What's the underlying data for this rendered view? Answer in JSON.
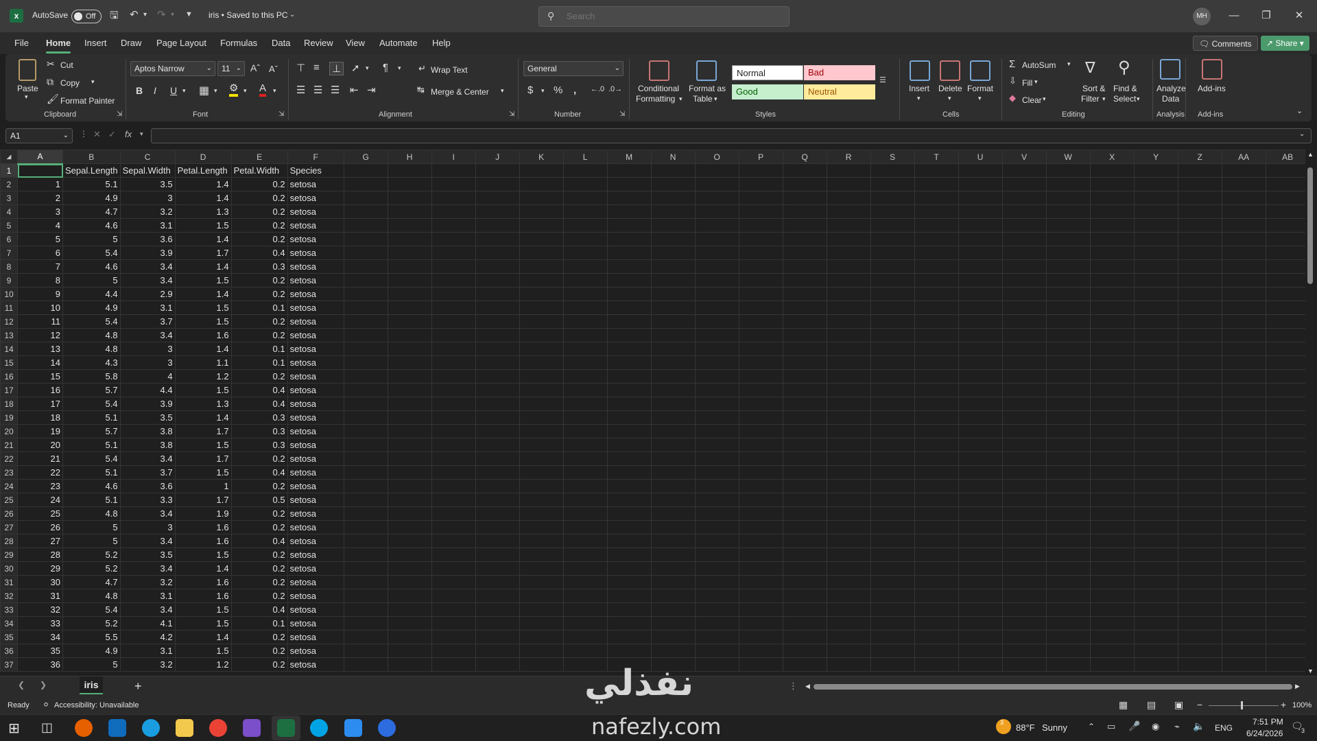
{
  "titlebar": {
    "autosave_label": "AutoSave",
    "autosave_state": "Off",
    "doc_title": "iris • Saved to this PC",
    "search_placeholder": "Search",
    "user_initials": "MH"
  },
  "menu": {
    "tabs": [
      "File",
      "Home",
      "Insert",
      "Draw",
      "Page Layout",
      "Formulas",
      "Data",
      "Review",
      "View",
      "Automate",
      "Help"
    ],
    "active": "Home",
    "comments_label": "Comments",
    "share_label": "Share"
  },
  "ribbon": {
    "clipboard": {
      "paste": "Paste",
      "cut": "Cut",
      "copy": "Copy",
      "format_painter": "Format Painter",
      "group": "Clipboard"
    },
    "font": {
      "name": "Aptos Narrow",
      "size": "11",
      "group": "Font"
    },
    "alignment": {
      "wrap": "Wrap Text",
      "merge": "Merge & Center",
      "group": "Alignment"
    },
    "number": {
      "format": "General",
      "group": "Number"
    },
    "styles": {
      "conditional": "Conditional",
      "conditional2": "Formatting",
      "format_table": "Format as",
      "format_table2": "Table",
      "normal": "Normal",
      "bad": "Bad",
      "good": "Good",
      "neutral": "Neutral",
      "group": "Styles"
    },
    "cells": {
      "insert": "Insert",
      "delete": "Delete",
      "format": "Format",
      "group": "Cells"
    },
    "editing": {
      "autosum": "AutoSum",
      "fill": "Fill",
      "clear": "Clear",
      "sort": "Sort &",
      "sort2": "Filter",
      "find": "Find &",
      "find2": "Select",
      "group": "Editing"
    },
    "analysis": {
      "analyze": "Analyze",
      "analyze2": "Data",
      "group": "Analysis"
    },
    "addins": {
      "label": "Add-ins",
      "group": "Add-ins"
    }
  },
  "formula_bar": {
    "name_box": "A1",
    "fx": "fx",
    "content": ""
  },
  "sheet": {
    "columns": [
      "A",
      "B",
      "C",
      "D",
      "E",
      "F",
      "G",
      "H",
      "I",
      "J",
      "K",
      "L",
      "M",
      "N",
      "O",
      "P",
      "Q",
      "R",
      "S",
      "T",
      "U",
      "V",
      "W",
      "X",
      "Y",
      "Z",
      "AA",
      "AB"
    ],
    "header": [
      "",
      "Sepal.Length",
      "Sepal.Width",
      "Petal.Length",
      "Petal.Width",
      "Species"
    ],
    "rows": [
      [
        "1",
        "5.1",
        "3.5",
        "1.4",
        "0.2",
        "setosa"
      ],
      [
        "2",
        "4.9",
        "3",
        "1.4",
        "0.2",
        "setosa"
      ],
      [
        "3",
        "4.7",
        "3.2",
        "1.3",
        "0.2",
        "setosa"
      ],
      [
        "4",
        "4.6",
        "3.1",
        "1.5",
        "0.2",
        "setosa"
      ],
      [
        "5",
        "5",
        "3.6",
        "1.4",
        "0.2",
        "setosa"
      ],
      [
        "6",
        "5.4",
        "3.9",
        "1.7",
        "0.4",
        "setosa"
      ],
      [
        "7",
        "4.6",
        "3.4",
        "1.4",
        "0.3",
        "setosa"
      ],
      [
        "8",
        "5",
        "3.4",
        "1.5",
        "0.2",
        "setosa"
      ],
      [
        "9",
        "4.4",
        "2.9",
        "1.4",
        "0.2",
        "setosa"
      ],
      [
        "10",
        "4.9",
        "3.1",
        "1.5",
        "0.1",
        "setosa"
      ],
      [
        "11",
        "5.4",
        "3.7",
        "1.5",
        "0.2",
        "setosa"
      ],
      [
        "12",
        "4.8",
        "3.4",
        "1.6",
        "0.2",
        "setosa"
      ],
      [
        "13",
        "4.8",
        "3",
        "1.4",
        "0.1",
        "setosa"
      ],
      [
        "14",
        "4.3",
        "3",
        "1.1",
        "0.1",
        "setosa"
      ],
      [
        "15",
        "5.8",
        "4",
        "1.2",
        "0.2",
        "setosa"
      ],
      [
        "16",
        "5.7",
        "4.4",
        "1.5",
        "0.4",
        "setosa"
      ],
      [
        "17",
        "5.4",
        "3.9",
        "1.3",
        "0.4",
        "setosa"
      ],
      [
        "18",
        "5.1",
        "3.5",
        "1.4",
        "0.3",
        "setosa"
      ],
      [
        "19",
        "5.7",
        "3.8",
        "1.7",
        "0.3",
        "setosa"
      ],
      [
        "20",
        "5.1",
        "3.8",
        "1.5",
        "0.3",
        "setosa"
      ],
      [
        "21",
        "5.4",
        "3.4",
        "1.7",
        "0.2",
        "setosa"
      ],
      [
        "22",
        "5.1",
        "3.7",
        "1.5",
        "0.4",
        "setosa"
      ],
      [
        "23",
        "4.6",
        "3.6",
        "1",
        "0.2",
        "setosa"
      ],
      [
        "24",
        "5.1",
        "3.3",
        "1.7",
        "0.5",
        "setosa"
      ],
      [
        "25",
        "4.8",
        "3.4",
        "1.9",
        "0.2",
        "setosa"
      ],
      [
        "26",
        "5",
        "3",
        "1.6",
        "0.2",
        "setosa"
      ],
      [
        "27",
        "5",
        "3.4",
        "1.6",
        "0.4",
        "setosa"
      ],
      [
        "28",
        "5.2",
        "3.5",
        "1.5",
        "0.2",
        "setosa"
      ],
      [
        "29",
        "5.2",
        "3.4",
        "1.4",
        "0.2",
        "setosa"
      ],
      [
        "30",
        "4.7",
        "3.2",
        "1.6",
        "0.2",
        "setosa"
      ],
      [
        "31",
        "4.8",
        "3.1",
        "1.6",
        "0.2",
        "setosa"
      ],
      [
        "32",
        "5.4",
        "3.4",
        "1.5",
        "0.4",
        "setosa"
      ],
      [
        "33",
        "5.2",
        "4.1",
        "1.5",
        "0.1",
        "setosa"
      ],
      [
        "34",
        "5.5",
        "4.2",
        "1.4",
        "0.2",
        "setosa"
      ],
      [
        "35",
        "4.9",
        "3.1",
        "1.5",
        "0.2",
        "setosa"
      ],
      [
        "36",
        "5",
        "3.2",
        "1.2",
        "0.2",
        "setosa"
      ]
    ]
  },
  "sheet_tabs": {
    "active": "iris"
  },
  "status": {
    "ready": "Ready",
    "accessibility": "Accessibility: Unavailable",
    "zoom": "100%"
  },
  "taskbar": {
    "weather_temp": "88°F",
    "weather_desc": "Sunny",
    "lang": "ENG",
    "time": "7:51 PM",
    "date": "6/24/2026",
    "badge": "3",
    "notif": "3"
  },
  "watermark": {
    "arabic": "نفذلي",
    "latin": "nafezly.com"
  },
  "colors": {
    "accent": "#56b07a",
    "bad_bg": "#ffc7ce",
    "good_bg": "#c6efce",
    "neutral_bg": "#ffeb9c"
  }
}
